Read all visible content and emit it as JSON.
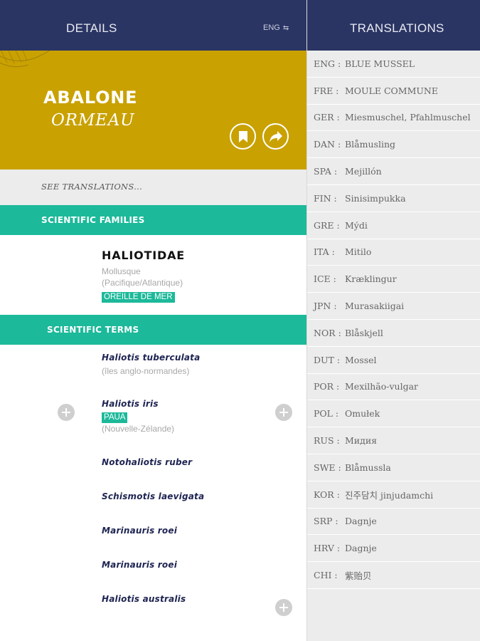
{
  "left_header": {
    "title": "DETAILS",
    "lang": "ENG",
    "lang_swap_glyph": "⇆"
  },
  "hero": {
    "title": "ABALONE",
    "subtitle": "ORMEAU",
    "bookmark_icon": "bookmark-icon",
    "share_icon": "share-icon",
    "color": "#c9a101"
  },
  "see_translations": "SEE TRANSLATIONS...",
  "families_section": {
    "label": "SCIENTIFIC FAMILIES",
    "family": {
      "name": "HALIOTIDAE",
      "line1": "Mollusque",
      "line2": "(Pacifique/Atlantique)",
      "tag": "OREILLE DE MER"
    }
  },
  "terms_section": {
    "label": "SCIENTIFIC TERMS",
    "terms": [
      {
        "name": "Haliotis tuberculata",
        "note": "(îles anglo-normandes)"
      },
      {
        "name": "Haliotis iris",
        "tag": "PAUA",
        "note": "(Nouvelle-Zélande)"
      },
      {
        "name": "Notohaliotis ruber"
      },
      {
        "name": "Schismotis laevigata"
      },
      {
        "name": "Marinauris roei"
      },
      {
        "name": "Marinauris roei"
      },
      {
        "name": "Haliotis australis"
      }
    ]
  },
  "right_header": {
    "title": "TRANSLATIONS"
  },
  "translations": [
    {
      "code": "ENG :",
      "name": "BLUE MUSSEL"
    },
    {
      "code": "FRE :",
      "name": "MOULE COMMUNE"
    },
    {
      "code": "GER :",
      "name": "Miesmuschel, Pfahlmuschel"
    },
    {
      "code": "DAN :",
      "name": "Blåmusling"
    },
    {
      "code": "SPA :",
      "name": "Mejillón"
    },
    {
      "code": "FIN :",
      "name": "Sinisimpukka"
    },
    {
      "code": "GRE :",
      "name": "Mýdi"
    },
    {
      "code": "ITA :",
      "name": "Mitilo"
    },
    {
      "code": "ICE :",
      "name": "Kræklingur"
    },
    {
      "code": "JPN :",
      "name": "Murasakiigai"
    },
    {
      "code": "NOR :",
      "name": "Blåskjell"
    },
    {
      "code": "DUT :",
      "name": "Mossel"
    },
    {
      "code": "POR :",
      "name": "Mexilhão-vulgar"
    },
    {
      "code": "POL :",
      "name": "Omułek"
    },
    {
      "code": "RUS :",
      "name": "Мидия"
    },
    {
      "code": "SWE :",
      "name": "Blåmussla"
    },
    {
      "code": "KOR :",
      "name": "진주담치 jinjudamchi"
    },
    {
      "code": "SRP :",
      "name": "Dagnje"
    },
    {
      "code": "HRV :",
      "name": "Dagnje"
    },
    {
      "code": "CHI :",
      "name": "紫贻贝"
    }
  ],
  "colors": {
    "header": "#2b3563",
    "accent": "#1cb99a",
    "hero": "#c9a101",
    "panel": "#ececec"
  }
}
